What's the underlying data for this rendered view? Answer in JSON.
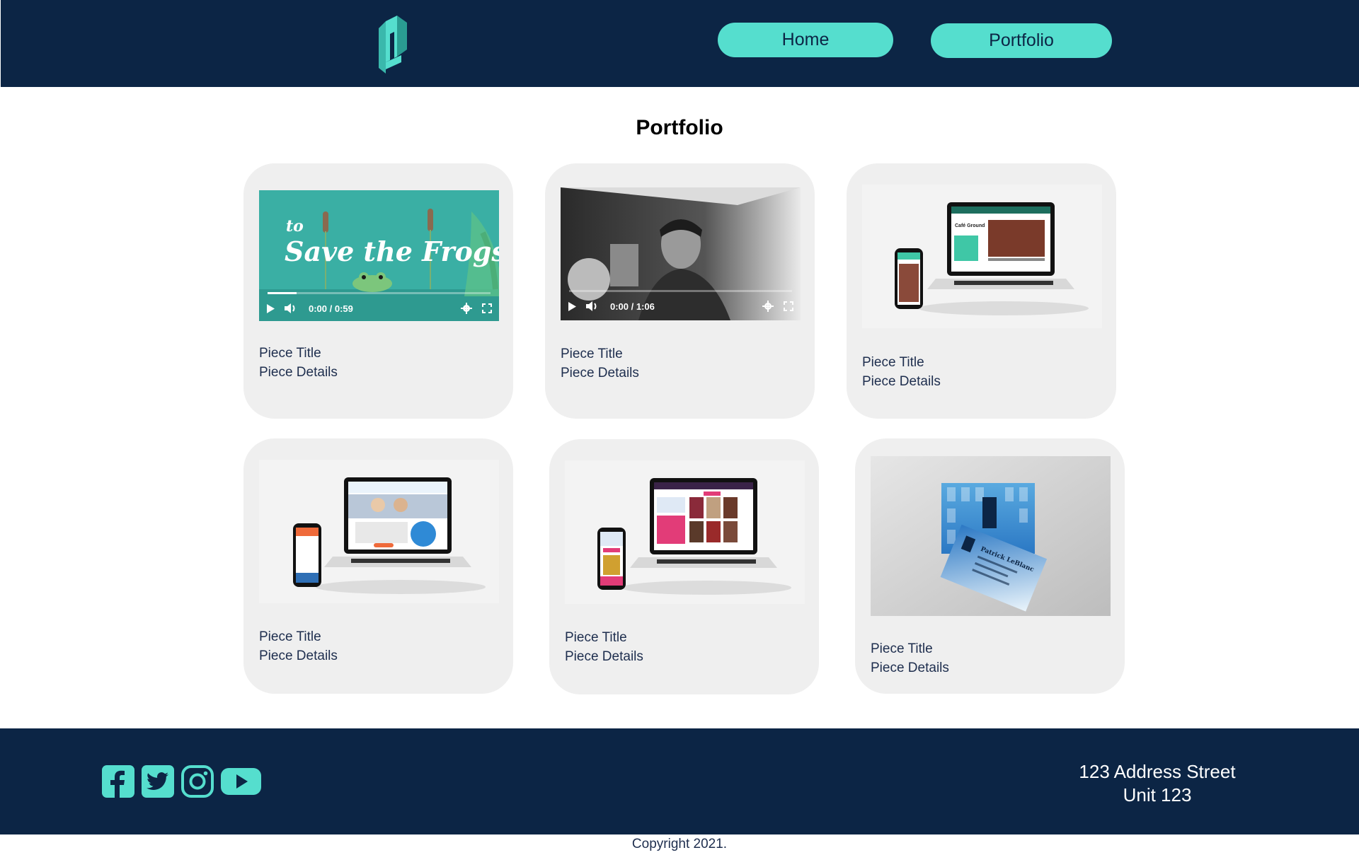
{
  "nav": {
    "home_label": "Home",
    "portfolio_label": "Portfolio"
  },
  "main": {
    "title": "Portfolio",
    "cards": [
      {
        "title": "Piece Title",
        "details": "Piece Details",
        "media": "video",
        "overlay_small": "to",
        "overlay_text": "Save the Frogs",
        "time": "0:00 / 0:59",
        "progress": 0.13
      },
      {
        "title": "Piece Title",
        "details": "Piece Details",
        "media": "video",
        "time": "0:00 / 1:06",
        "progress": 0.0
      },
      {
        "title": "Piece Title",
        "details": "Piece Details",
        "media": "device-mockup",
        "screen_text": "Café Ground"
      },
      {
        "title": "Piece Title",
        "details": "Piece Details",
        "media": "device-mockup"
      },
      {
        "title": "Piece Title",
        "details": "Piece Details",
        "media": "device-mockup"
      },
      {
        "title": "Piece Title",
        "details": "Piece Details",
        "media": "business-cards",
        "card_text": "Patrick LeBlanc"
      }
    ]
  },
  "footer": {
    "social": [
      "facebook-icon",
      "twitter-icon",
      "instagram-icon",
      "youtube-icon"
    ],
    "address_line1": "123 Address Street",
    "address_line2": "Unit 123",
    "copyright": "Copyright 2021."
  },
  "colors": {
    "navy": "#0c2545",
    "teal": "#55dece",
    "card_bg": "#efefef"
  }
}
